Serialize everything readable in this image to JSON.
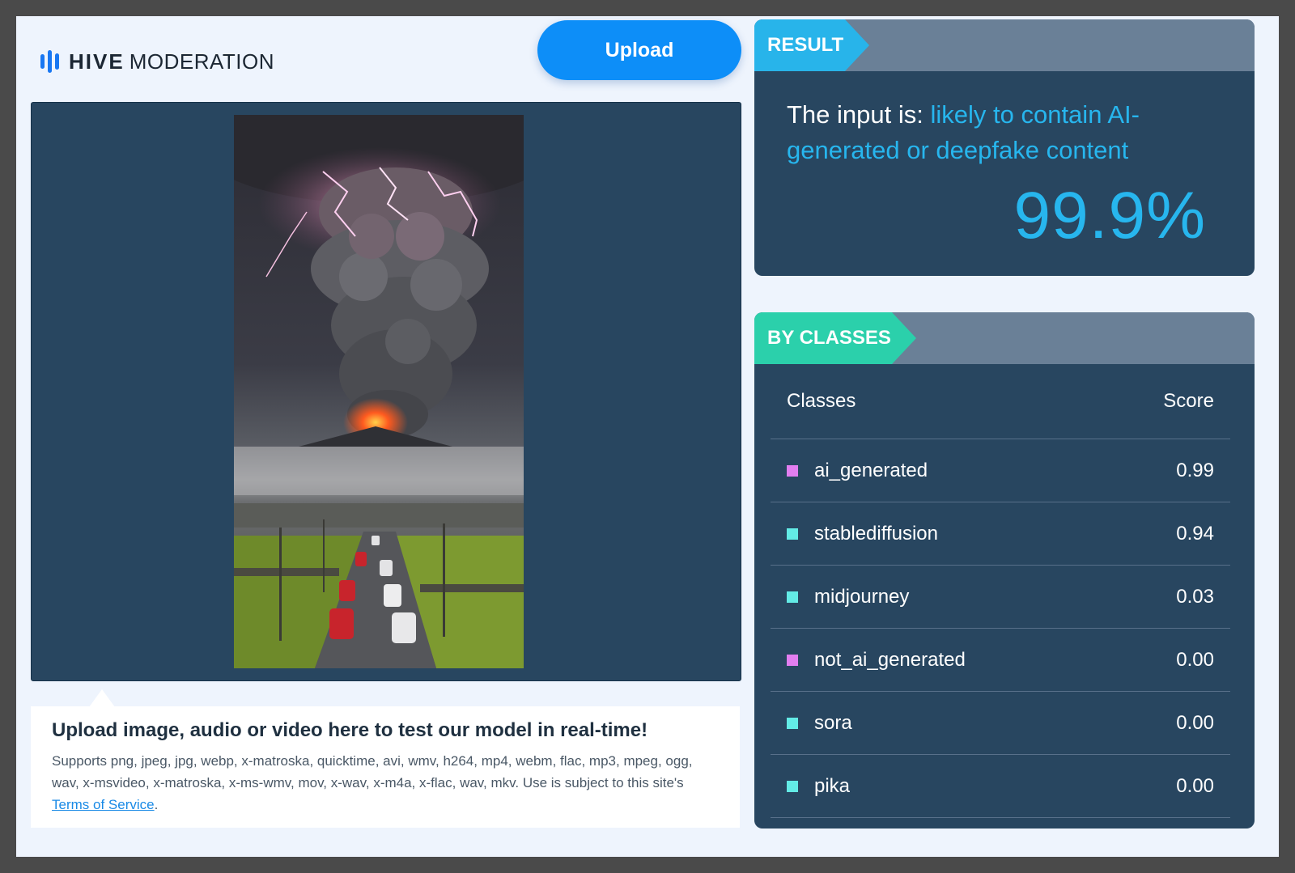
{
  "header": {
    "logo_hive": "HIVE",
    "logo_moderation": "MODERATION",
    "upload_label": "Upload"
  },
  "info": {
    "title": "Upload image, audio or video here to test our model in real-time!",
    "text_before_link": "Supports png, jpeg, jpg, webp, x-matroska, quicktime, avi, wmv, h264, mp4, webm, flac, mp3, mpeg, ogg, wav, x-msvideo, x-matroska, x-ms-wmv, mov, x-wav, x-m4a, x-flac, wav, mkv. Use is subject to this site's ",
    "link_text": "Terms of Service",
    "text_after_link": "."
  },
  "result": {
    "tag": "RESULT",
    "prefix": "The input is: ",
    "verdict": "likely to contain AI-generated or deepfake content",
    "percent": "99.9%"
  },
  "classes": {
    "tag": "BY CLASSES",
    "col_classes": "Classes",
    "col_score": "Score",
    "rows": [
      {
        "name": "ai_generated",
        "score": "0.99",
        "color": "#e27ef0"
      },
      {
        "name": "stablediffusion",
        "score": "0.94",
        "color": "#63ebe6"
      },
      {
        "name": "midjourney",
        "score": "0.03",
        "color": "#63ebe6"
      },
      {
        "name": "not_ai_generated",
        "score": "0.00",
        "color": "#e27ef0"
      },
      {
        "name": "sora",
        "score": "0.00",
        "color": "#63ebe6"
      },
      {
        "name": "pika",
        "score": "0.00",
        "color": "#63ebe6"
      }
    ]
  },
  "colors": {
    "accent_blue": "#27b6ee",
    "upload_blue": "#0d8ef8",
    "classes_green": "#2bd0ab",
    "panel_navy": "#284660"
  }
}
